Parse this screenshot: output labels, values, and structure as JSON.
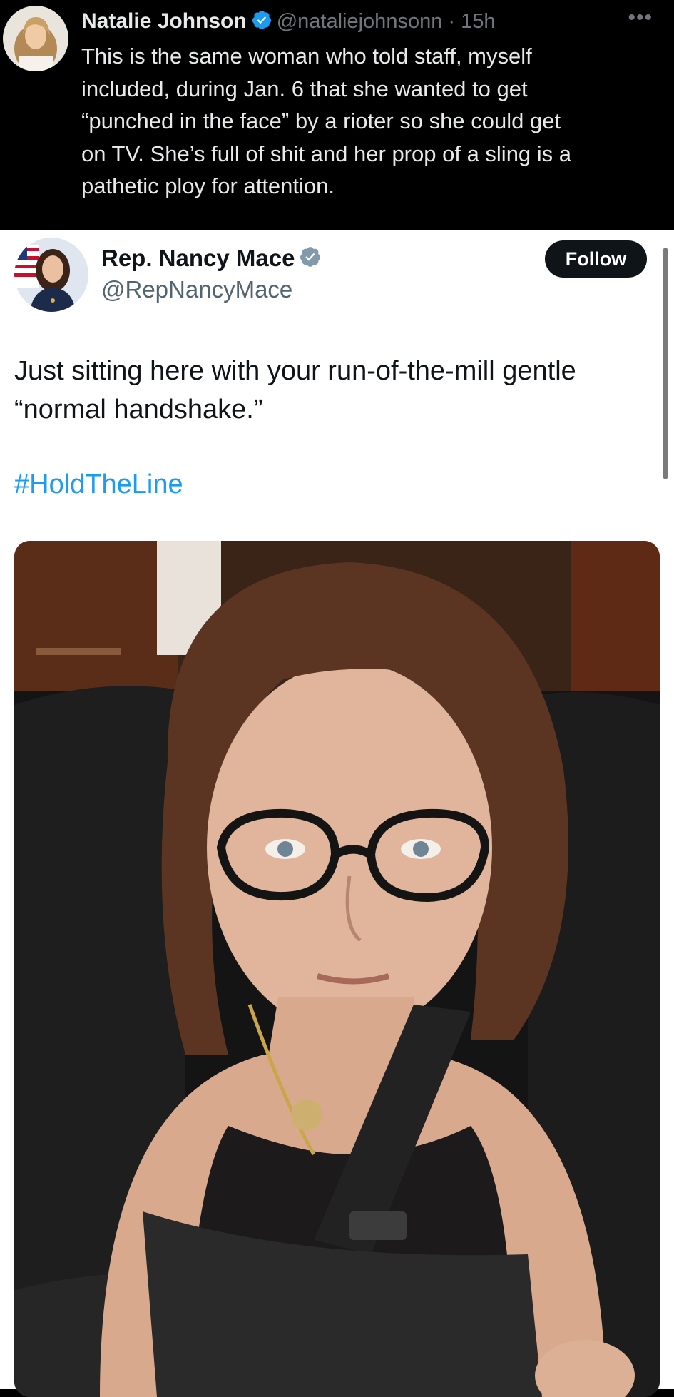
{
  "quote_tweet": {
    "author_name": "Natalie Johnson",
    "handle_time": "@nataliejohnsonn · 15h",
    "more_icon": "more-horizontal-icon",
    "text_lines": [
      "This is the same woman who told staff, myself",
      "included, during Jan. 6 that she wanted to get",
      "“punched in the face” by a rioter so she could get",
      "on TV. She’s full of shit and her prop of a sling is a",
      "pathetic ploy for attention."
    ],
    "verified_color": "#1d9bf0"
  },
  "tweet": {
    "author_name": "Rep. Nancy Mace",
    "handle": "@RepNancyMace",
    "follow_label": "Follow",
    "text_lines": [
      "Just sitting here with your run-of-the-mill gentle",
      "“normal handshake.”"
    ],
    "hashtag": "#HoldTheLine",
    "verified_color": "#829aab",
    "link_color": "#1d9bf0"
  }
}
